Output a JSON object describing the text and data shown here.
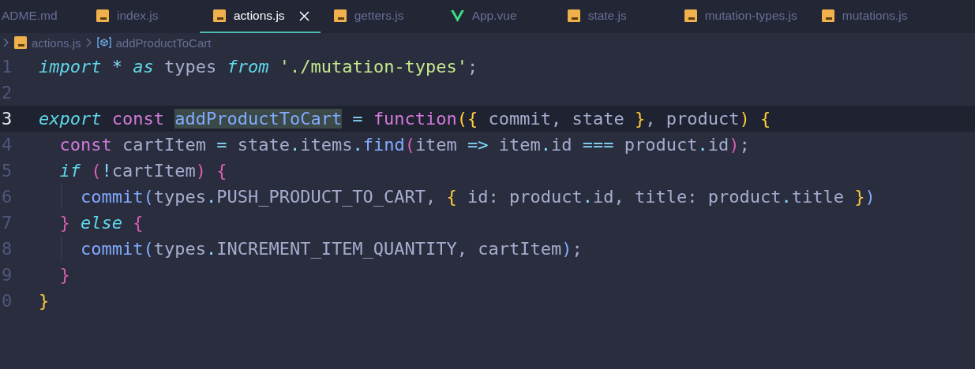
{
  "tabs": [
    {
      "label": "ADME.md",
      "kind": "plain",
      "selected": false
    },
    {
      "label": "index.js",
      "kind": "js",
      "selected": false
    },
    {
      "label": "actions.js",
      "kind": "js",
      "selected": true
    },
    {
      "label": "getters.js",
      "kind": "js",
      "selected": false
    },
    {
      "label": "App.vue",
      "kind": "vue",
      "selected": false
    },
    {
      "label": "state.js",
      "kind": "js",
      "selected": false
    },
    {
      "label": "mutation-types.js",
      "kind": "js",
      "selected": false
    },
    {
      "label": "mutations.js",
      "kind": "js",
      "selected": false
    }
  ],
  "breadcrumb": {
    "file": "actions.js",
    "symbol": "addProductToCart"
  },
  "lines": [
    {
      "number": "1",
      "current": false,
      "guide": false,
      "tokens": [
        {
          "kind": "kw",
          "text": "import"
        },
        {
          "kind": "op",
          "text": " * "
        },
        {
          "kind": "kw",
          "text": "as"
        },
        {
          "kind": "var",
          "text": " types "
        },
        {
          "kind": "kw",
          "text": "from"
        },
        {
          "kind": "str",
          "text": " './mutation-types'"
        },
        {
          "kind": "var",
          "text": ";"
        }
      ]
    },
    {
      "number": "2",
      "current": false,
      "guide": false
    },
    {
      "number": "3",
      "current": true,
      "guide": false,
      "tokens": [
        {
          "kind": "kw",
          "text": "export"
        },
        {
          "kind": "storage",
          "text": " const "
        },
        {
          "kind": "match",
          "text": "addProductToCart"
        },
        {
          "kind": "op",
          "text": " = "
        },
        {
          "kind": "storage",
          "text": "function"
        },
        {
          "kind": "brace1",
          "text": "({"
        },
        {
          "kind": "var",
          "text": " commit, state "
        },
        {
          "kind": "brace1",
          "text": "}"
        },
        {
          "kind": "var",
          "text": ", product"
        },
        {
          "kind": "brace1",
          "text": ")"
        },
        {
          "kind": "brace1",
          "text": " {"
        }
      ]
    },
    {
      "number": "4",
      "current": false,
      "guide": false,
      "tokens": [
        {
          "kind": "storage",
          "text": "  const"
        },
        {
          "kind": "var",
          "text": " cartItem "
        },
        {
          "kind": "op",
          "text": "="
        },
        {
          "kind": "var",
          "text": " state"
        },
        {
          "kind": "op",
          "text": "."
        },
        {
          "kind": "var",
          "text": "items"
        },
        {
          "kind": "op",
          "text": "."
        },
        {
          "kind": "func",
          "text": "find"
        },
        {
          "kind": "brace2",
          "text": "("
        },
        {
          "kind": "var",
          "text": "item "
        },
        {
          "kind": "op",
          "text": "=>"
        },
        {
          "kind": "var",
          "text": " item"
        },
        {
          "kind": "op",
          "text": "."
        },
        {
          "kind": "var",
          "text": "id "
        },
        {
          "kind": "op",
          "text": "==="
        },
        {
          "kind": "var",
          "text": " product"
        },
        {
          "kind": "op",
          "text": "."
        },
        {
          "kind": "var",
          "text": "id"
        },
        {
          "kind": "brace2",
          "text": ")"
        },
        {
          "kind": "var",
          "text": ";"
        }
      ]
    },
    {
      "number": "5",
      "current": false,
      "guide": false,
      "tokens": [
        {
          "kind": "kw",
          "text": "  if"
        },
        {
          "kind": "brace2",
          "text": " ("
        },
        {
          "kind": "op",
          "text": "!"
        },
        {
          "kind": "var",
          "text": "cartItem"
        },
        {
          "kind": "brace2",
          "text": ")"
        },
        {
          "kind": "brace2",
          "text": " {"
        }
      ]
    },
    {
      "number": "6",
      "current": false,
      "guide": true,
      "tokens": [
        {
          "kind": "func",
          "text": "    commit"
        },
        {
          "kind": "brace3",
          "text": "("
        },
        {
          "kind": "var",
          "text": "types"
        },
        {
          "kind": "op",
          "text": "."
        },
        {
          "kind": "var",
          "text": "PUSH_PRODUCT_TO_CART, "
        },
        {
          "kind": "brace1",
          "text": "{"
        },
        {
          "kind": "var",
          "text": " id: product"
        },
        {
          "kind": "op",
          "text": "."
        },
        {
          "kind": "var",
          "text": "id, title: product"
        },
        {
          "kind": "op",
          "text": "."
        },
        {
          "kind": "var",
          "text": "title "
        },
        {
          "kind": "brace1",
          "text": "}"
        },
        {
          "kind": "brace3",
          "text": ")"
        }
      ]
    },
    {
      "number": "7",
      "current": false,
      "guide": false,
      "tokens": [
        {
          "kind": "brace2",
          "text": "  }"
        },
        {
          "kind": "kw",
          "text": " else"
        },
        {
          "kind": "brace2",
          "text": " {"
        }
      ]
    },
    {
      "number": "8",
      "current": false,
      "guide": true,
      "tokens": [
        {
          "kind": "func",
          "text": "    commit"
        },
        {
          "kind": "brace3",
          "text": "("
        },
        {
          "kind": "var",
          "text": "types"
        },
        {
          "kind": "op",
          "text": "."
        },
        {
          "kind": "var",
          "text": "INCREMENT_ITEM_QUANTITY, cartItem"
        },
        {
          "kind": "brace3",
          "text": ")"
        },
        {
          "kind": "var",
          "text": ";"
        }
      ]
    },
    {
      "number": "9",
      "current": false,
      "guide": false,
      "tokens": [
        {
          "kind": "brace2",
          "text": "  }"
        }
      ]
    },
    {
      "number": "0",
      "current": false,
      "guide": false,
      "tokens": [
        {
          "kind": "brace1",
          "text": "}"
        }
      ]
    }
  ]
}
